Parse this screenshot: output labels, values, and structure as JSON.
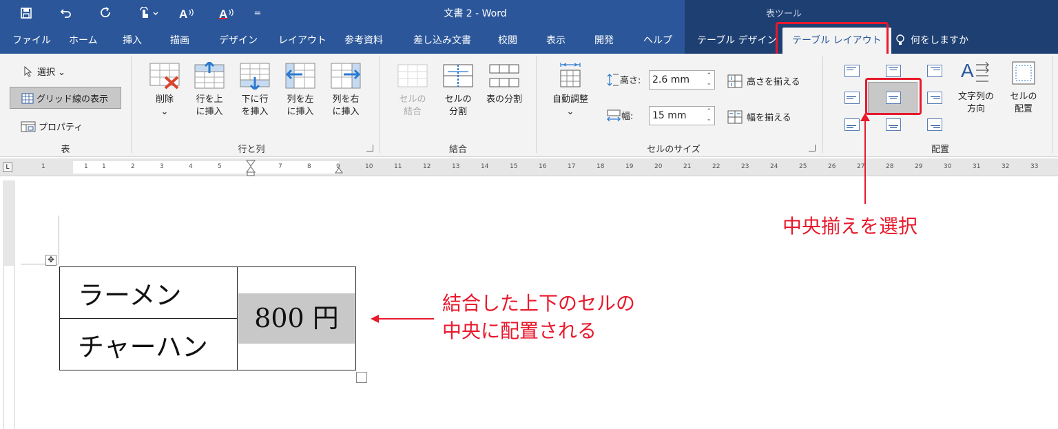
{
  "titlebar": {
    "doc_title": "文書 2  -  Word",
    "tool_context": "表ツール",
    "qat": [
      {
        "icon": "save-icon",
        "glyph": "🖫"
      },
      {
        "icon": "undo-icon",
        "glyph": "↶"
      },
      {
        "icon": "redo-icon",
        "glyph": "↻"
      },
      {
        "icon": "touch-mode-icon",
        "glyph": "☝ ⌄"
      },
      {
        "icon": "read-aloud-icon",
        "glyph": "A⁾⁾"
      },
      {
        "icon": "read-aloud-red-icon",
        "glyph": "A⁾⁾"
      },
      {
        "icon": "customize-qat-icon",
        "glyph": "="
      }
    ]
  },
  "tabs": {
    "file": "ファイル",
    "home": "ホーム",
    "insert": "挿入",
    "draw": "描画",
    "design": "デザイン",
    "layout": "レイアウト",
    "references": "参考資料",
    "mailings": "差し込み文書",
    "review": "校閲",
    "view": "表示",
    "developer": "開発",
    "help": "ヘルプ",
    "table_design": "テーブル デザイン",
    "table_layout": "テーブル レイアウト",
    "tell_me": "何をしますか"
  },
  "ribbon": {
    "table_group": {
      "label": "表",
      "select": "選択",
      "gridlines": "グリッド線の表示",
      "properties": "プロパティ"
    },
    "rows_cols_group": {
      "label": "行と列",
      "delete": "削除",
      "insert_above_1": "行を上",
      "insert_above_2": "に挿入",
      "insert_below_1": "下に行",
      "insert_below_2": "を挿入",
      "insert_left_1": "列を左",
      "insert_left_2": "に挿入",
      "insert_right_1": "列を右",
      "insert_right_2": "に挿入"
    },
    "merge_group": {
      "label": "結合",
      "merge_1": "セルの",
      "merge_2": "結合",
      "split_1": "セルの",
      "split_2": "分割",
      "split_table": "表の分割"
    },
    "cell_size_group": {
      "label": "セルのサイズ",
      "autofit": "自動調整",
      "height_label": "高さ:",
      "height_value": "2.6 mm",
      "width_label": "幅:",
      "width_value": "15 mm",
      "distribute_rows": "高さを揃える",
      "distribute_cols": "幅を揃える"
    },
    "alignment_group": {
      "label": "配置",
      "text_direction_1": "文字列の",
      "text_direction_2": "方向",
      "cell_margins_1": "セルの",
      "cell_margins_2": "配置",
      "selected_alignment": "align-center-center"
    }
  },
  "ruler": {
    "ticks": [
      "1",
      "1",
      "1",
      "2",
      "3",
      "4",
      "5",
      "7",
      "8",
      "9",
      "10",
      "11",
      "12",
      "13",
      "14",
      "15",
      "16",
      "17",
      "18",
      "19",
      "20",
      "21",
      "22",
      "23",
      "24",
      "25",
      "26",
      "27",
      "28",
      "29",
      "30",
      "31",
      "32",
      "33"
    ]
  },
  "document": {
    "table": {
      "rows": [
        "ラーメン",
        "チャーハン"
      ],
      "price": "800 円"
    }
  },
  "annotations": {
    "top_callout": "中央揃えを選択",
    "right_callout_line1": "結合した上下のセルの",
    "right_callout_line2": "中央に配置される",
    "color": "#e8192c"
  }
}
